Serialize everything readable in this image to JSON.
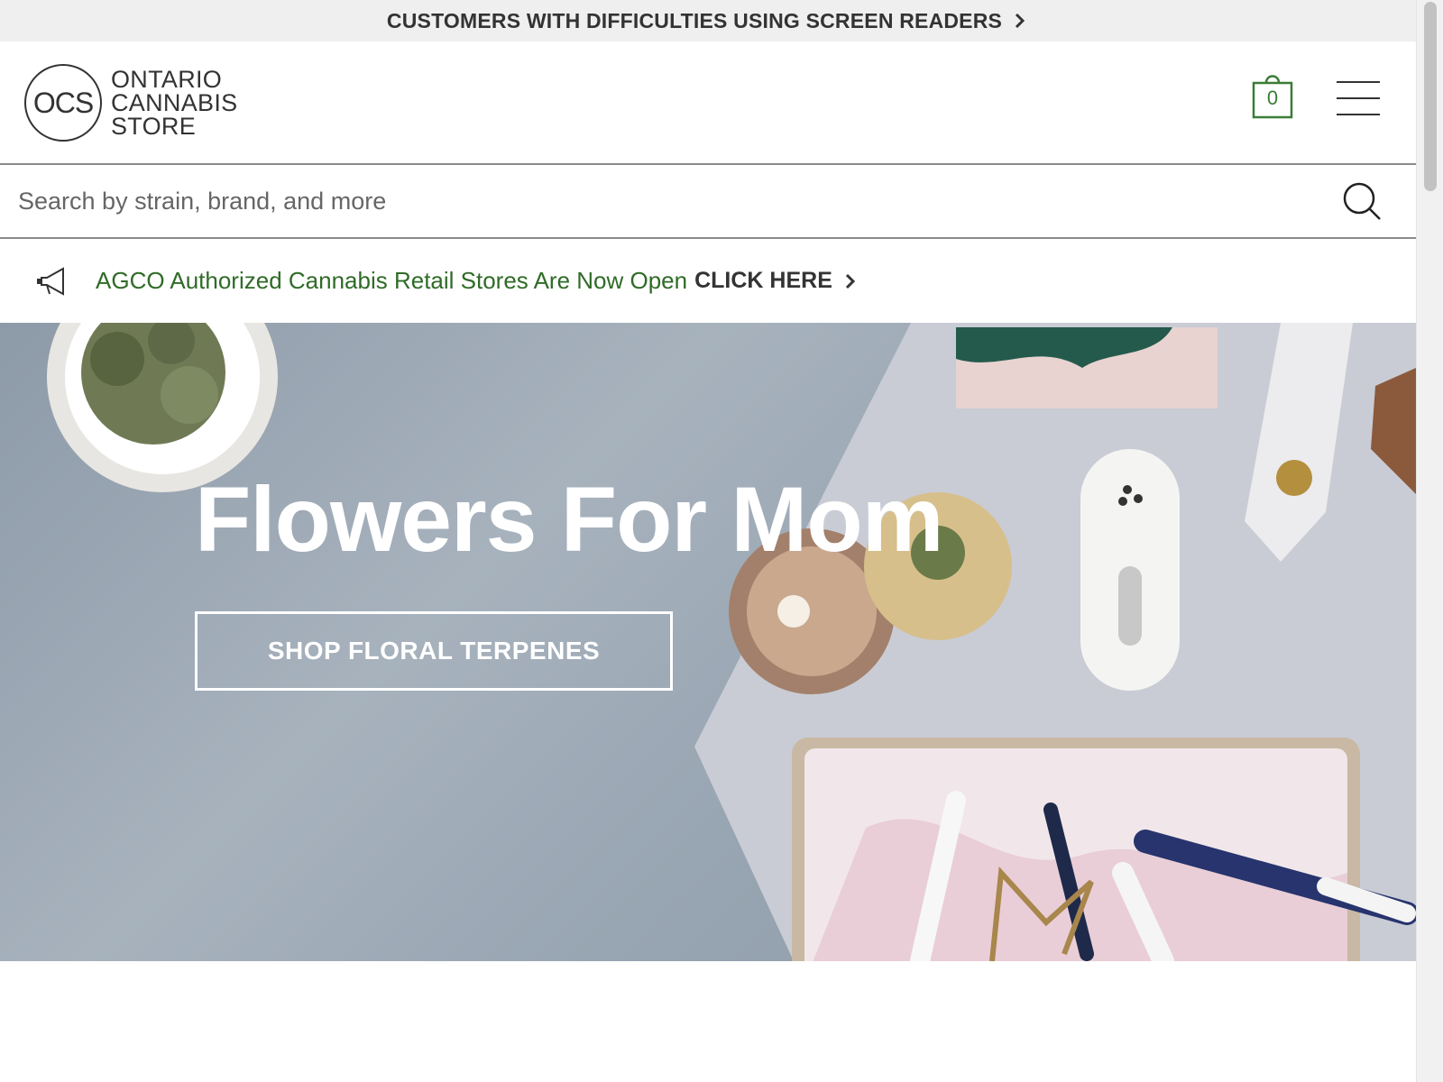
{
  "a11y_bar": {
    "label": "CUSTOMERS WITH DIFFICULTIES USING SCREEN READERS"
  },
  "header": {
    "logo": {
      "mark": "OCS",
      "line1": "ONTARIO",
      "line2": "CANNABIS",
      "line3": "STORE"
    },
    "cart_count": "0"
  },
  "search": {
    "placeholder": "Search by strain, brand, and more"
  },
  "announcement": {
    "message": "AGCO Authorized Cannabis Retail Stores Are Now Open",
    "cta": "CLICK HERE"
  },
  "hero": {
    "title": "Flowers For Mom",
    "button_label": "SHOP FLORAL TERPENES"
  },
  "colors": {
    "accent_green": "#3a7d36",
    "announcement_green": "#2f6b27",
    "top_bar_bg": "#efefef",
    "hero_bg": "#98a5b2"
  },
  "icons": [
    "chevron-right-icon",
    "shopping-bag-icon",
    "hamburger-menu-icon",
    "search-icon",
    "megaphone-icon"
  ]
}
